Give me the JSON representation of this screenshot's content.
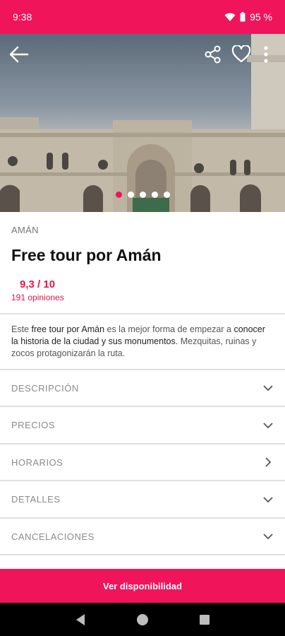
{
  "status": {
    "time": "9:38",
    "battery": "95 %"
  },
  "hero": {
    "slide_count": 5,
    "active_slide": 1
  },
  "tour": {
    "city": "AMÁN",
    "title": "Free tour por Amán",
    "rating": "9,3 / 10",
    "reviews": "191 opiniones",
    "summary_parts": [
      {
        "text": "Este ",
        "bold": false
      },
      {
        "text": "free tour por Amán",
        "bold": true
      },
      {
        "text": " es la mejor forma de empezar a ",
        "bold": false
      },
      {
        "text": "conocer la historia de la ciudad y sus monumentos",
        "bold": true
      },
      {
        "text": ". Mezquitas, ruinas y zocos protagonizarán la ruta.",
        "bold": false
      }
    ]
  },
  "sections": [
    {
      "label": "DESCRIPCIÓN",
      "icon": "chevron-down-icon"
    },
    {
      "label": "PRECIOS",
      "icon": "chevron-down-icon"
    },
    {
      "label": "HORARIOS",
      "icon": "chevron-right-icon"
    },
    {
      "label": "DETALLES",
      "icon": "chevron-down-icon"
    },
    {
      "label": "CANCELACIONES",
      "icon": "chevron-down-icon"
    }
  ],
  "cta": {
    "label": "Ver disponibilidad"
  },
  "colors": {
    "brand": "#f0145a",
    "rating": "#e8144f"
  }
}
